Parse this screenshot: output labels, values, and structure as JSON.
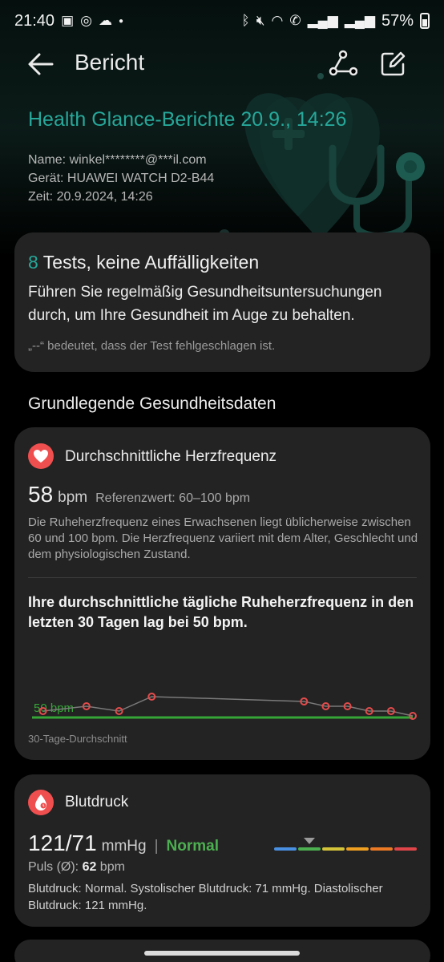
{
  "status_bar": {
    "time": "21:40",
    "battery": "57%",
    "left_icons": [
      "gallery-icon",
      "whatsapp-icon",
      "cloud-icon",
      "dot-icon"
    ],
    "right_icons": [
      "bluetooth-icon",
      "mute-icon",
      "wifi-icon",
      "wifi-call-icon",
      "signal-icon",
      "signal-icon",
      "battery-icon"
    ]
  },
  "appbar": {
    "title": "Bericht",
    "back_icon": "arrow-left-icon",
    "share_icon": "share-icon",
    "edit_icon": "edit-icon"
  },
  "header": {
    "report_title": "Health Glance-Berichte 20.9., 14:26",
    "name": "Name: winkel********@***il.com",
    "device": "Gerät: HUAWEI WATCH D2-B44",
    "time": "Zeit: 20.9.2024, 14:26"
  },
  "summary": {
    "count": "8",
    "heading": " Tests, keine Auffälligkeiten",
    "description": "Führen Sie regelmäßig Gesundheitsuntersuchungen durch, um Ihre Gesundheit im Auge zu behalten.",
    "note": "„--“ bedeutet, dass der Test fehlgeschlagen ist."
  },
  "section_title": "Grundlegende Gesundheitsdaten",
  "heart_rate": {
    "label": "Durchschnittliche Herzfrequenz",
    "icon": "heart-icon",
    "value": "58",
    "unit": "bpm",
    "reference": "Referenzwert: 60–100 bpm",
    "description": "Die Ruheherzfrequenz eines Erwachsenen liegt üblicherweise zwischen 60 und 100 bpm. Die Herzfrequenz variiert mit dem Alter, Geschlecht und dem physiologischen Zustand.",
    "resting_statement": "Ihre durchschnittliche tägliche Ruheherzfrequenz in den letzten 30 Tagen lag bei 50 bpm.",
    "chart_caption": "30-Tage-Durchschnitt"
  },
  "chart_data": {
    "type": "line",
    "title": "",
    "average_line": {
      "label": "50 bpm",
      "value": 50
    },
    "x": [
      1,
      5,
      8,
      11,
      25,
      27,
      29,
      31,
      33,
      35
    ],
    "values": [
      50,
      51,
      50,
      53,
      52,
      51,
      51,
      50,
      50,
      49
    ],
    "xlim": [
      0,
      35
    ],
    "ylim": [
      46,
      56
    ],
    "colors": {
      "average": "#35a537",
      "points": "#e44b4b",
      "line": "#7a7a7a"
    }
  },
  "blood_pressure": {
    "label": "Blutdruck",
    "icon": "blood-drop-icon",
    "value": "121/71",
    "unit": "mmHg",
    "separator": "|",
    "status": "Normal",
    "pulse_label": "Puls (Ø): ",
    "pulse_value": "62",
    "pulse_unit": " bpm",
    "description": "Blutdruck: Normal. Systolischer Blutdruck: 71 mmHg. Diastolischer Blutdruck: 121 mmHg.",
    "scale_colors": [
      "#4a90e2",
      "#4caf50",
      "#d4c43a",
      "#f0a020",
      "#ec7a25",
      "#e0454a"
    ],
    "scale_marker_index": 1
  },
  "colors": {
    "accent": "#26a89a",
    "card_bg": "#232323",
    "normal_green": "#4caf50",
    "heart_red": "#ef4f4f"
  }
}
